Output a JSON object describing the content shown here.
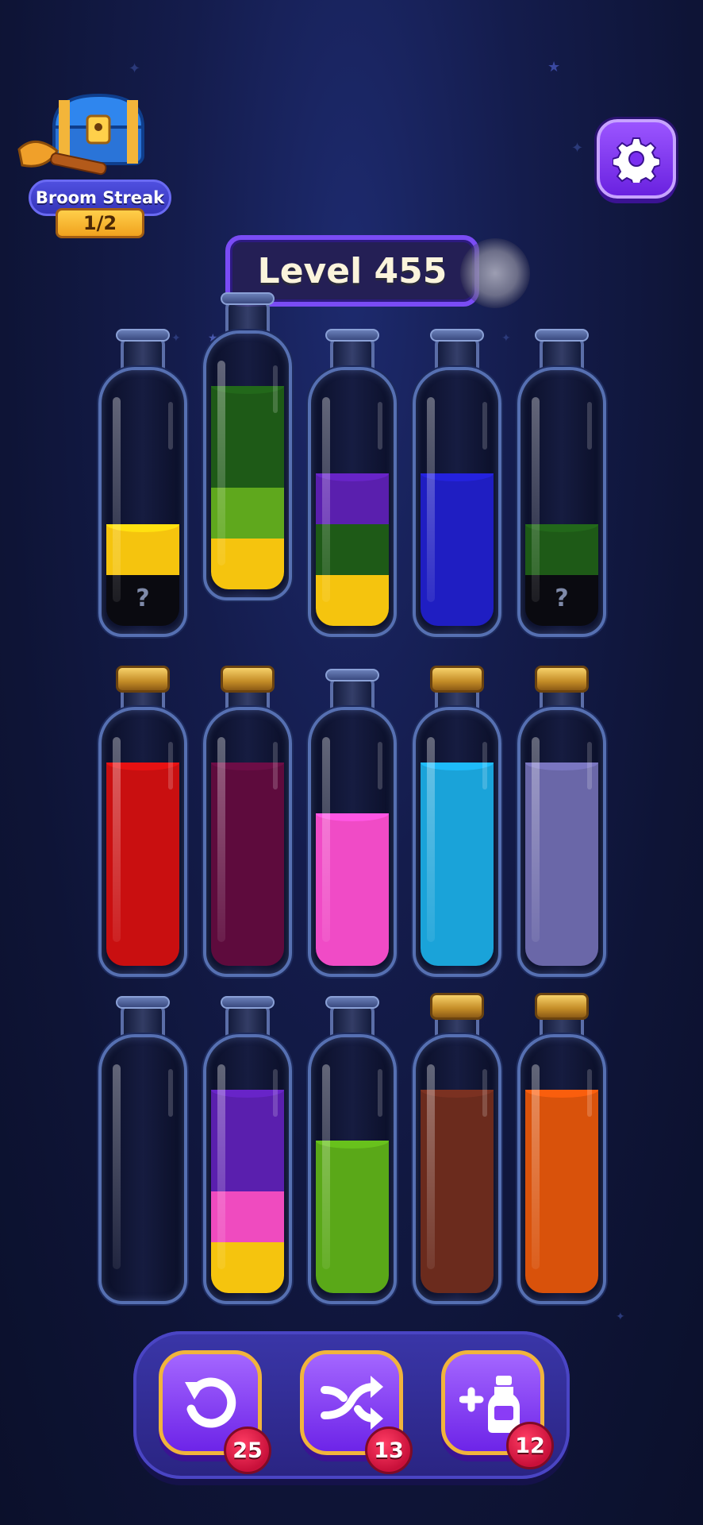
{
  "hud": {
    "streak_label": "Broom Streak",
    "streak_count": "1/2",
    "level_label": "Level 455",
    "settings_icon": "gear-icon"
  },
  "bottles": [
    {
      "row": 0,
      "col": 0,
      "cap": "open",
      "hidden_marker": "?",
      "layers": [
        {
          "color": "#0a0a10",
          "units": 1,
          "hidden": true
        },
        {
          "color": "#f5c40e",
          "units": 1
        }
      ]
    },
    {
      "row": 0,
      "col": 1,
      "cap": "open",
      "raised": true,
      "layers": [
        {
          "color": "#f5c40e",
          "units": 1
        },
        {
          "color": "#5fa81d",
          "units": 1
        },
        {
          "color": "#1e5a17",
          "units": 2
        }
      ]
    },
    {
      "row": 0,
      "col": 2,
      "cap": "open",
      "layers": [
        {
          "color": "#f5c40e",
          "units": 1
        },
        {
          "color": "#1e5a17",
          "units": 1
        },
        {
          "color": "#5a1fae",
          "units": 1
        }
      ]
    },
    {
      "row": 0,
      "col": 3,
      "cap": "open",
      "layers": [
        {
          "color": "#1f1ec2",
          "units": 3
        }
      ]
    },
    {
      "row": 0,
      "col": 4,
      "cap": "open",
      "hidden_marker": "?",
      "layers": [
        {
          "color": "#0a0a10",
          "units": 1,
          "hidden": true
        },
        {
          "color": "#1e5a17",
          "units": 1
        }
      ]
    },
    {
      "row": 1,
      "col": 0,
      "cap": "cork",
      "layers": [
        {
          "color": "#c90f10",
          "units": 4
        }
      ]
    },
    {
      "row": 1,
      "col": 1,
      "cap": "cork",
      "layers": [
        {
          "color": "#5e0b3d",
          "units": 4
        }
      ]
    },
    {
      "row": 1,
      "col": 2,
      "cap": "open",
      "layers": [
        {
          "color": "#f04bc6",
          "units": 3
        }
      ]
    },
    {
      "row": 1,
      "col": 3,
      "cap": "cork",
      "layers": [
        {
          "color": "#1aa3d9",
          "units": 4
        }
      ]
    },
    {
      "row": 1,
      "col": 4,
      "cap": "cork",
      "layers": [
        {
          "color": "#6a67a8",
          "units": 4
        }
      ]
    },
    {
      "row": 2,
      "col": 0,
      "cap": "open",
      "layers": []
    },
    {
      "row": 2,
      "col": 1,
      "cap": "open",
      "layers": [
        {
          "color": "#f5c40e",
          "units": 1
        },
        {
          "color": "#ef4bbf",
          "units": 1
        },
        {
          "color": "#5a1fae",
          "units": 2
        }
      ]
    },
    {
      "row": 2,
      "col": 2,
      "cap": "open",
      "layers": [
        {
          "color": "#5aa818",
          "units": 3
        }
      ]
    },
    {
      "row": 2,
      "col": 3,
      "cap": "cork",
      "layers": [
        {
          "color": "#6b2b1d",
          "units": 4
        }
      ]
    },
    {
      "row": 2,
      "col": 4,
      "cap": "cork",
      "layers": [
        {
          "color": "#d9520b",
          "units": 4
        }
      ]
    }
  ],
  "powerups": [
    {
      "name": "undo",
      "icon": "undo-icon",
      "count": "25"
    },
    {
      "name": "shuffle",
      "icon": "shuffle-icon",
      "count": "13"
    },
    {
      "name": "add-bottle",
      "icon": "add-bottle-icon",
      "count": "12"
    }
  ]
}
